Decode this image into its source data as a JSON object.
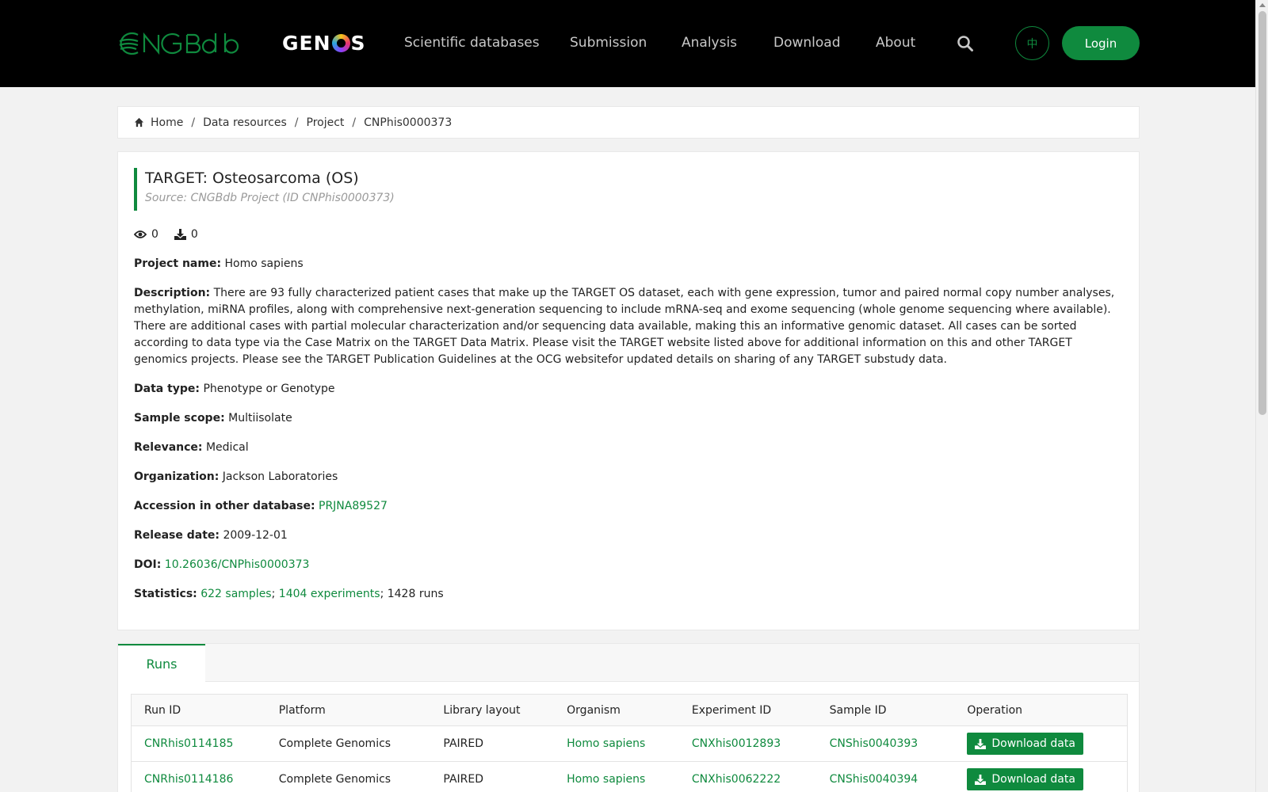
{
  "header": {
    "logo_primary": "CNGBdb",
    "logo_secondary": "GENOS",
    "nav": [
      "Scientific databases",
      "Submission",
      "Analysis",
      "Download",
      "About"
    ],
    "lang_label": "中",
    "login_label": "Login"
  },
  "breadcrumb": [
    "Home",
    "Data resources",
    "Project",
    "CNPhis0000373"
  ],
  "project": {
    "title": "TARGET: Osteosarcoma (OS)",
    "source": "Source: CNGBdb Project (ID CNPhis0000373)",
    "views": "0",
    "downloads": "0",
    "fields": {
      "project_name": {
        "label": "Project name:",
        "value": "Homo sapiens"
      },
      "description": {
        "label": "Description:",
        "value": "There are 93 fully characterized patient cases that make up the TARGET OS dataset, each with gene expression, tumor and paired normal copy number analyses, methylation, miRNA profiles, along with comprehensive next-generation sequencing to include mRNA-seq and exome sequencing (whole genome sequencing where available). There are additional cases with partial molecular characterization and/or sequencing data available, making this an informative genomic dataset. All cases can be sorted according to data type via the Case Matrix on the TARGET Data Matrix. Please visit the TARGET website listed above for additional information on this and other TARGET genomics projects. Please see the TARGET Publication Guidelines at the OCG websitefor updated details on sharing of any TARGET substudy data."
      },
      "data_type": {
        "label": "Data type:",
        "value": "Phenotype or Genotype"
      },
      "sample_scope": {
        "label": "Sample scope:",
        "value": "Multiisolate"
      },
      "relevance": {
        "label": "Relevance:",
        "value": "Medical"
      },
      "organization": {
        "label": "Organization:",
        "value": "Jackson Laboratories"
      },
      "accession": {
        "label": "Accession in other database:",
        "value": "PRJNA89527"
      },
      "release_date": {
        "label": "Release date:",
        "value": "2009-12-01"
      },
      "doi": {
        "label": "DOI:",
        "value": "10.26036/CNPhis0000373"
      },
      "statistics": {
        "label": "Statistics:",
        "samples": "622 samples",
        "sep1": ";",
        "experiments": "1404 experiments",
        "runs": "; 1428 runs"
      }
    }
  },
  "runs": {
    "tab_label": "Runs",
    "columns": [
      "Run ID",
      "Platform",
      "Library layout",
      "Organism",
      "Experiment ID",
      "Sample ID",
      "Operation"
    ],
    "rows": [
      {
        "run_id": "CNRhis0114185",
        "platform": "Complete Genomics",
        "layout": "PAIRED",
        "organism": "Homo sapiens",
        "experiment_id": "CNXhis0012893",
        "sample_id": "CNShis0040393",
        "operation": "Download data"
      },
      {
        "run_id": "CNRhis0114186",
        "platform": "Complete Genomics",
        "layout": "PAIRED",
        "organism": "Homo sapiens",
        "experiment_id": "CNXhis0062222",
        "sample_id": "CNShis0040394",
        "operation": "Download data"
      }
    ]
  },
  "colors": {
    "accent": "#0f8a3e",
    "header_bg": "#000000",
    "page_bg": "#f2f2f2"
  }
}
